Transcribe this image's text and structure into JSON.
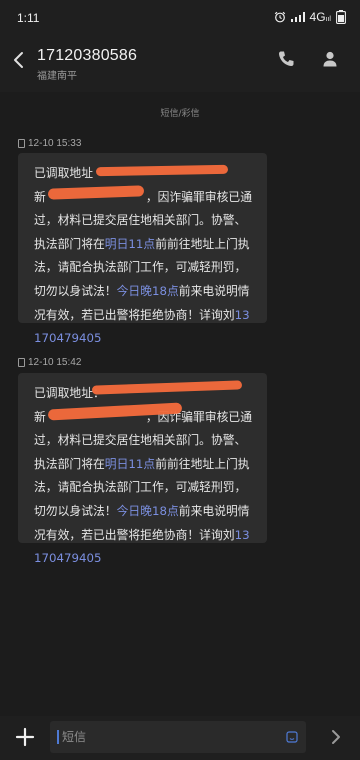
{
  "status": {
    "time": "1:11",
    "network": "4G",
    "network_sub": "ııl"
  },
  "header": {
    "number": "17120380586",
    "location": "福建南平"
  },
  "thread": {
    "channel_label": "短信/彩信",
    "messages": [
      {
        "time": "12-10 15:33",
        "p1": "已调取地址",
        "p2": "新",
        "p3": "，因诈骗罪审核已通过，材料已提交居住地相关部门。协警、执法部门将在",
        "link1": "明日11点",
        "p4": "前前往地址上门执法，请配合执法部门工作，可减轻刑罚，切勿以身试法！",
        "link2": "今日晚18点",
        "p5": "前来电说明情况有效，若已出警将拒绝协商！详询刘",
        "link3": "13170479405"
      },
      {
        "time": "12-10 15:42",
        "p1": "已调取地址：",
        "p2": "新",
        "p3": "，因诈骗罪审核已通过，材料已提交居住地相关部门。协警、执法部门将在",
        "link1": "明日11点",
        "p4": "前前往地址上门执法，请配合执法部门工作，可减轻刑罚，切勿以身试法！",
        "link2": "今日晚18点",
        "p5": "前来电说明情况有效，若已出警将拒绝协商！详询刘",
        "link3": "13170479405"
      }
    ]
  },
  "composer": {
    "placeholder": "短信"
  },
  "colors": {
    "background": "#1c1c1c",
    "bubble": "#2d2d2d",
    "link": "#7b8fe0",
    "redaction": "#f26a3c"
  },
  "icons": [
    "back-arrow-icon",
    "phone-icon",
    "contact-icon",
    "plus-icon",
    "emoji-icon",
    "send-icon",
    "alarm-icon",
    "signal-icon",
    "battery-icon"
  ]
}
